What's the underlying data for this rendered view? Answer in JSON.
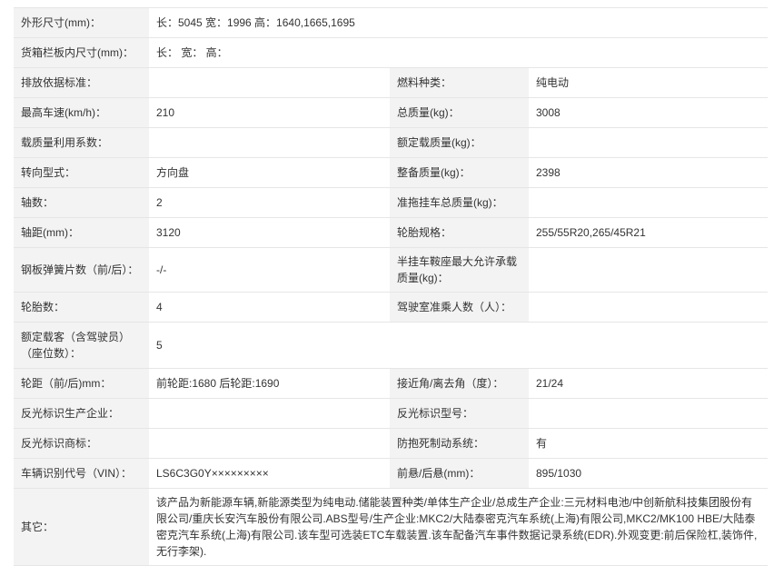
{
  "rows": [
    {
      "l1": "外形尺寸(mm)：",
      "v1": "长：5045 宽：1996 高：1640,1665,1695"
    },
    {
      "l1": "货箱栏板内尺寸(mm)：",
      "v1": "长：  宽：  高："
    },
    {
      "l1": "排放依据标准：",
      "v1": "",
      "l2": "燃料种类：",
      "v2": "纯电动"
    },
    {
      "l1": "最高车速(km/h)：",
      "v1": "210",
      "l2": "总质量(kg)：",
      "v2": "3008"
    },
    {
      "l1": "载质量利用系数：",
      "v1": "",
      "l2": "额定载质量(kg)：",
      "v2": ""
    },
    {
      "l1": "转向型式：",
      "v1": "方向盘",
      "l2": "整备质量(kg)：",
      "v2": "2398"
    },
    {
      "l1": "轴数：",
      "v1": "2",
      "l2": "准拖挂车总质量(kg)：",
      "v2": ""
    },
    {
      "l1": "轴距(mm)：",
      "v1": "3120",
      "l2": "轮胎规格：",
      "v2": "255/55R20,265/45R21"
    },
    {
      "l1": "钢板弹簧片数（前/后）：",
      "v1": "-/-",
      "l2": "半挂车鞍座最大允许承载质量(kg)：",
      "v2": ""
    },
    {
      "l1": "轮胎数：",
      "v1": "4",
      "l2": "驾驶室准乘人数（人）：",
      "v2": ""
    },
    {
      "l1": "额定载客（含驾驶员）（座位数）：",
      "v1": "5"
    },
    {
      "l1": "轮距（前/后)mm：",
      "v1": "前轮距:1680 后轮距:1690",
      "l2": "接近角/离去角（度）：",
      "v2": "21/24"
    },
    {
      "l1": "反光标识生产企业：",
      "v1": "",
      "l2": "反光标识型号：",
      "v2": ""
    },
    {
      "l1": "反光标识商标：",
      "v1": "",
      "l2": "防抱死制动系统：",
      "v2": "有"
    },
    {
      "l1": "车辆识别代号（VIN）：",
      "v1": "LS6C3G0Y×××××××××",
      "l2": "前悬/后悬(mm)：",
      "v2": "895/1030"
    },
    {
      "l1": "其它：",
      "v1": "该产品为新能源车辆,新能源类型为纯电动.储能装置种类/单体生产企业/总成生产企业:三元材料电池/中创新航科技集团股份有限公司/重庆长安汽车股份有限公司.ABS型号/生产企业:MKC2/大陆泰密克汽车系统(上海)有限公司,MKC2/MK100 HBE/大陆泰密克汽车系统(上海)有限公司.该车型可选装ETC车载装置.该车配备汽车事件数据记录系统(EDR).外观变更:前后保险杠,装饰件,无行李架)."
    }
  ]
}
